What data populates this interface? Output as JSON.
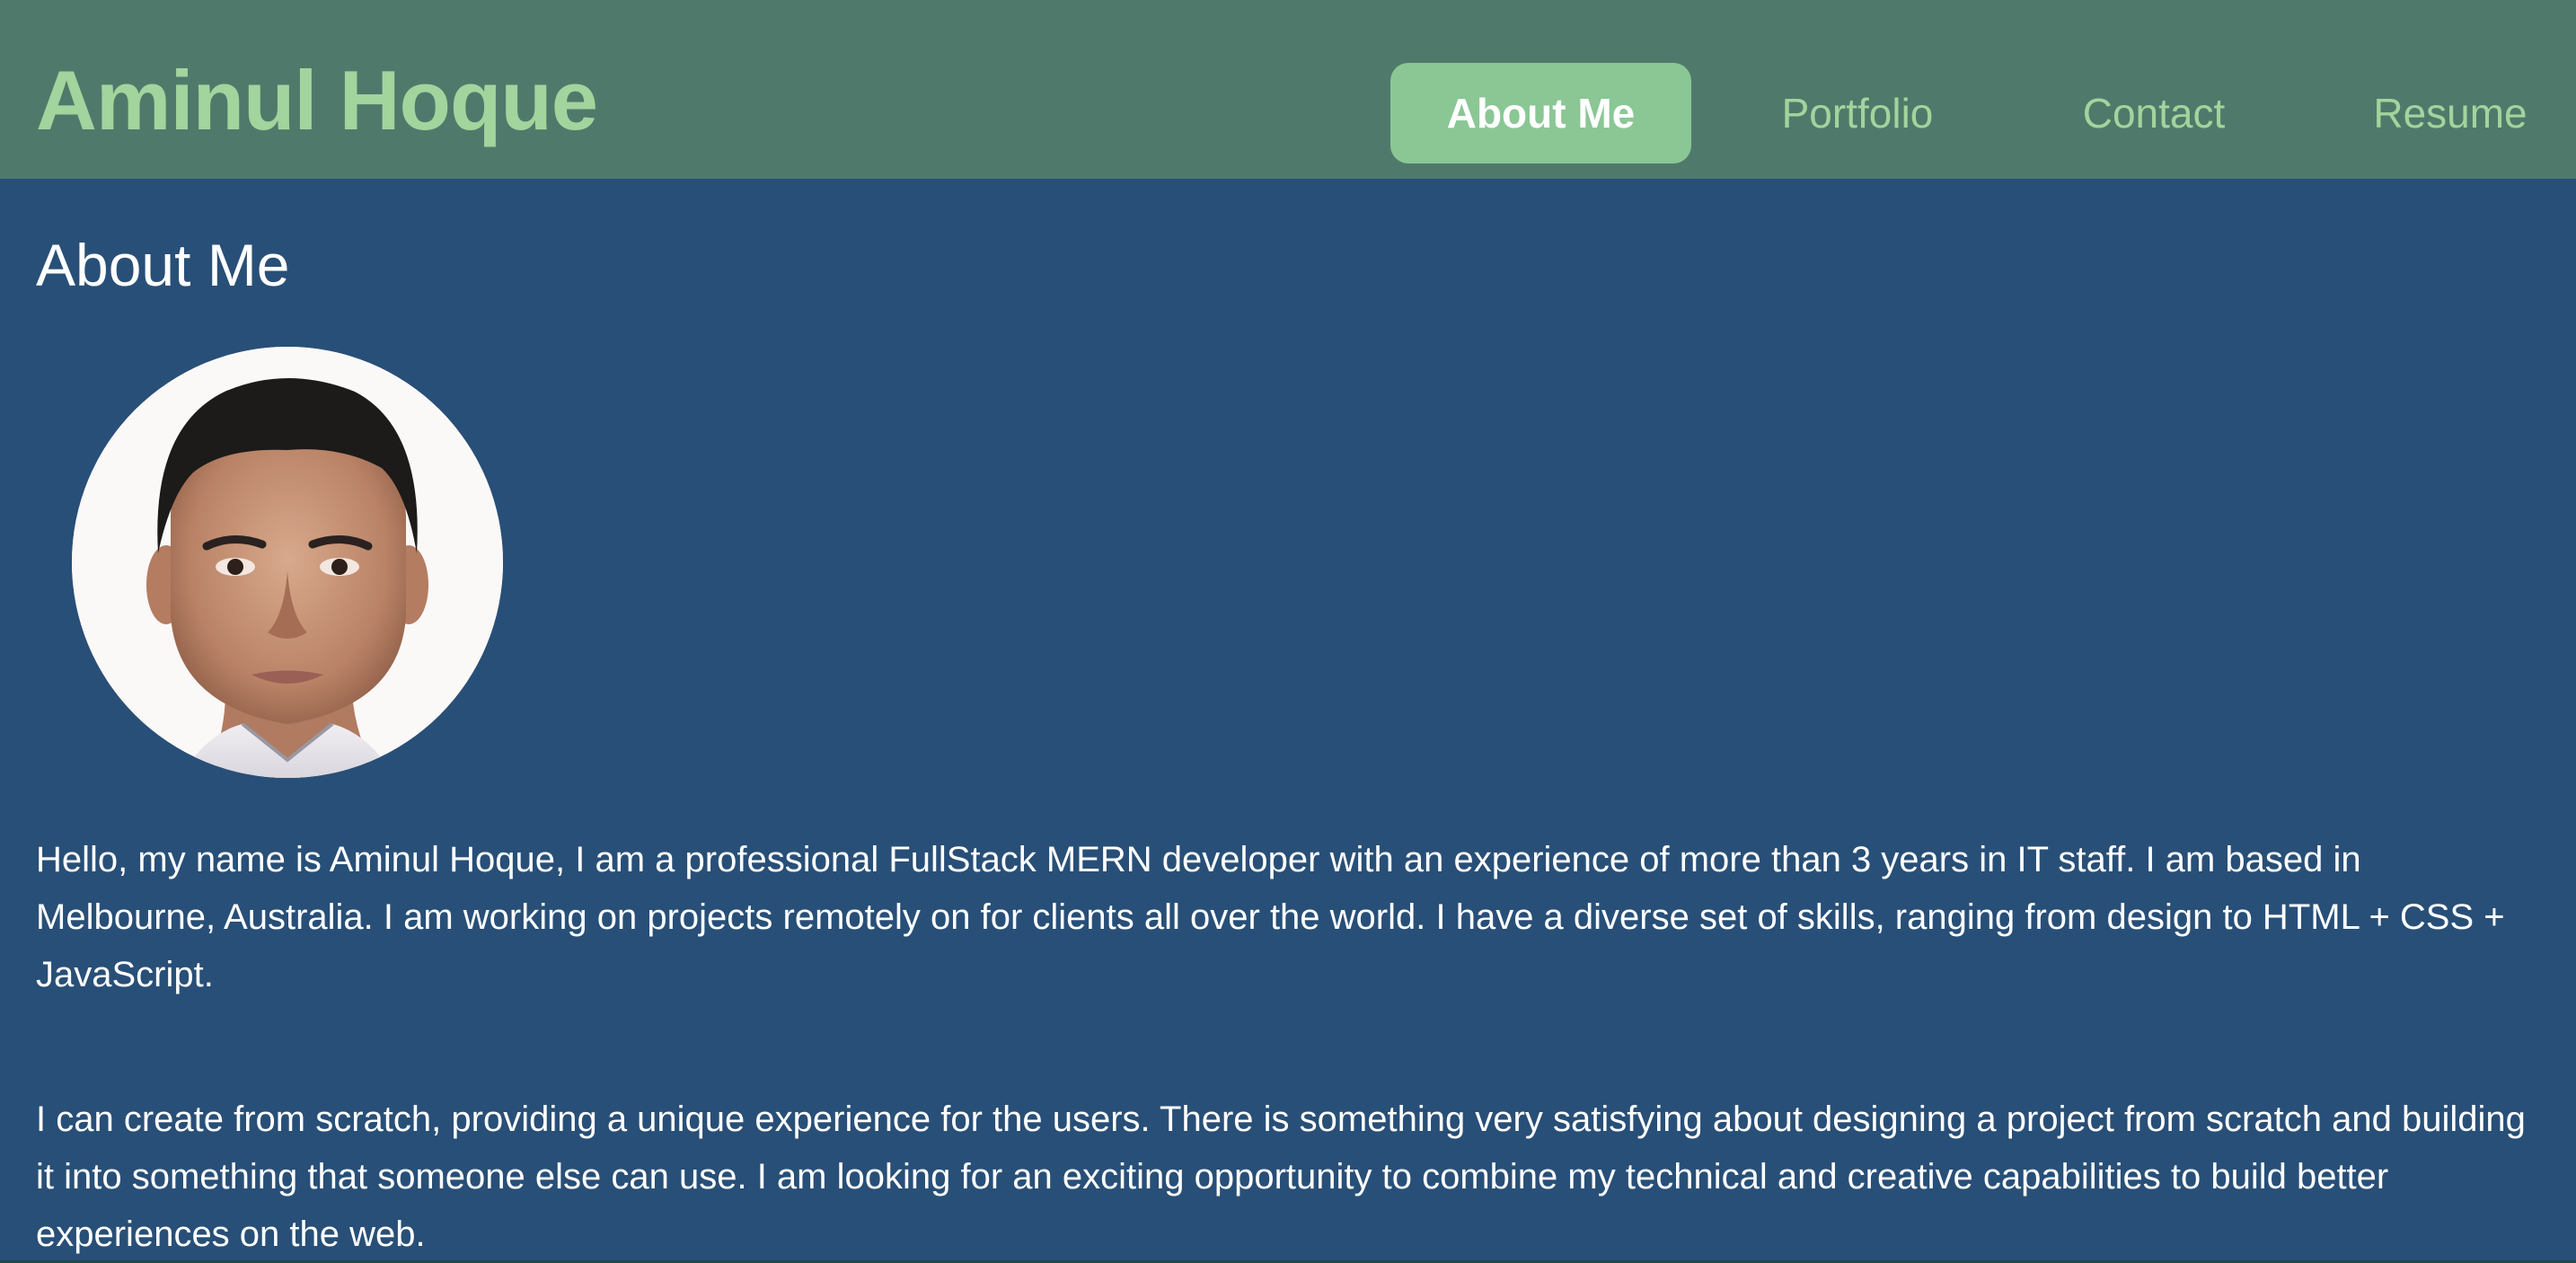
{
  "header": {
    "brand": "Aminul Hoque",
    "nav": [
      {
        "label": "About Me",
        "active": true
      },
      {
        "label": "Portfolio",
        "active": false
      },
      {
        "label": "Contact",
        "active": false
      },
      {
        "label": "Resume",
        "active": false
      }
    ]
  },
  "main": {
    "title": "About Me",
    "avatar_alt": "profile-photo",
    "paragraphs": [
      "Hello, my name is Aminul Hoque, I am a professional FullStack MERN developer with an experience of more than 3 years in IT staff. I am based in Melbourne, Australia. I am working on projects remotely on for clients all over the world. I have a diverse set of skills, ranging from design to HTML + CSS + JavaScript.",
      "I can create from scratch, providing a unique experience for the users. There is something very satisfying about designing a project from scratch and building it into something that someone else can use. I am looking for an exciting opportunity to combine my technical and creative capabilities to build better experiences on the web."
    ]
  },
  "colors": {
    "header_bg": "#4f7a6b",
    "main_bg": "#284f77",
    "accent": "#a2d49d",
    "active_tab_bg": "#8ac795",
    "text": "#ffffff"
  }
}
